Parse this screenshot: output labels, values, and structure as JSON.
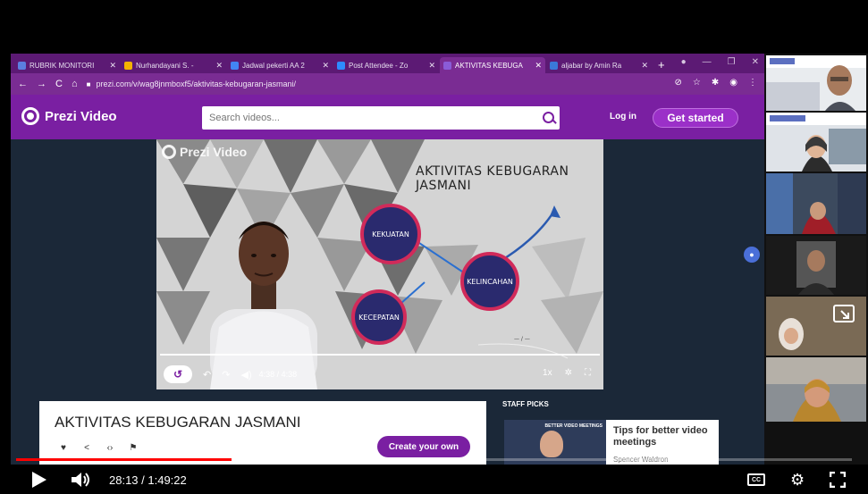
{
  "browser": {
    "tabs": [
      {
        "label": "RUBRIK MONITORI",
        "color": "#5b7ee0",
        "active": false
      },
      {
        "label": "Nurhandayani S. -",
        "color": "#f4b400",
        "active": false
      },
      {
        "label": "Jadwal pekerti AA 2",
        "color": "#4285f4",
        "active": false
      },
      {
        "label": "Post Attendee - Zo",
        "color": "#2d8cff",
        "active": false
      },
      {
        "label": "AKTIVITAS KEBUGA",
        "color": "#8a5cd8",
        "active": true
      },
      {
        "label": "aljabar by Amin Ra",
        "color": "#3a78d8",
        "active": false
      }
    ],
    "new_tab": "+",
    "url": "prezi.com/v/wag8jnmboxf5/aktivitas-kebugaran-jasmani/"
  },
  "prezi": {
    "brand": "Prezi Video",
    "search_placeholder": "Search videos...",
    "login": "Log in",
    "get_started": "Get started"
  },
  "video": {
    "watermark": "Prezi Video",
    "slide_title": "AKTIVITAS KEBUGARAN JASMANI",
    "bubbles": [
      "KEKUATAN",
      "KELINCAHAN",
      "KECEPATAN"
    ],
    "time": "4:38 / 4:38",
    "speed": "1x",
    "progress": 1.0
  },
  "info": {
    "title": "AKTIVITAS KEBUGARAN JASMANI",
    "create_button": "Create your own"
  },
  "staff_picks": {
    "heading": "STAFF PICKS",
    "pick_tag": "BETTER VIDEO MEETINGS",
    "pick_title": "Tips for better video meetings",
    "pick_author": "Spencer Waldron"
  },
  "player": {
    "time": "28:13 / 1:49:22",
    "played_fraction": 0.258,
    "loaded_fraction": 0.272,
    "cc": "CC"
  },
  "colors": {
    "prezi_purple": "#7a1fa2",
    "youtube_red": "#ff0000"
  }
}
